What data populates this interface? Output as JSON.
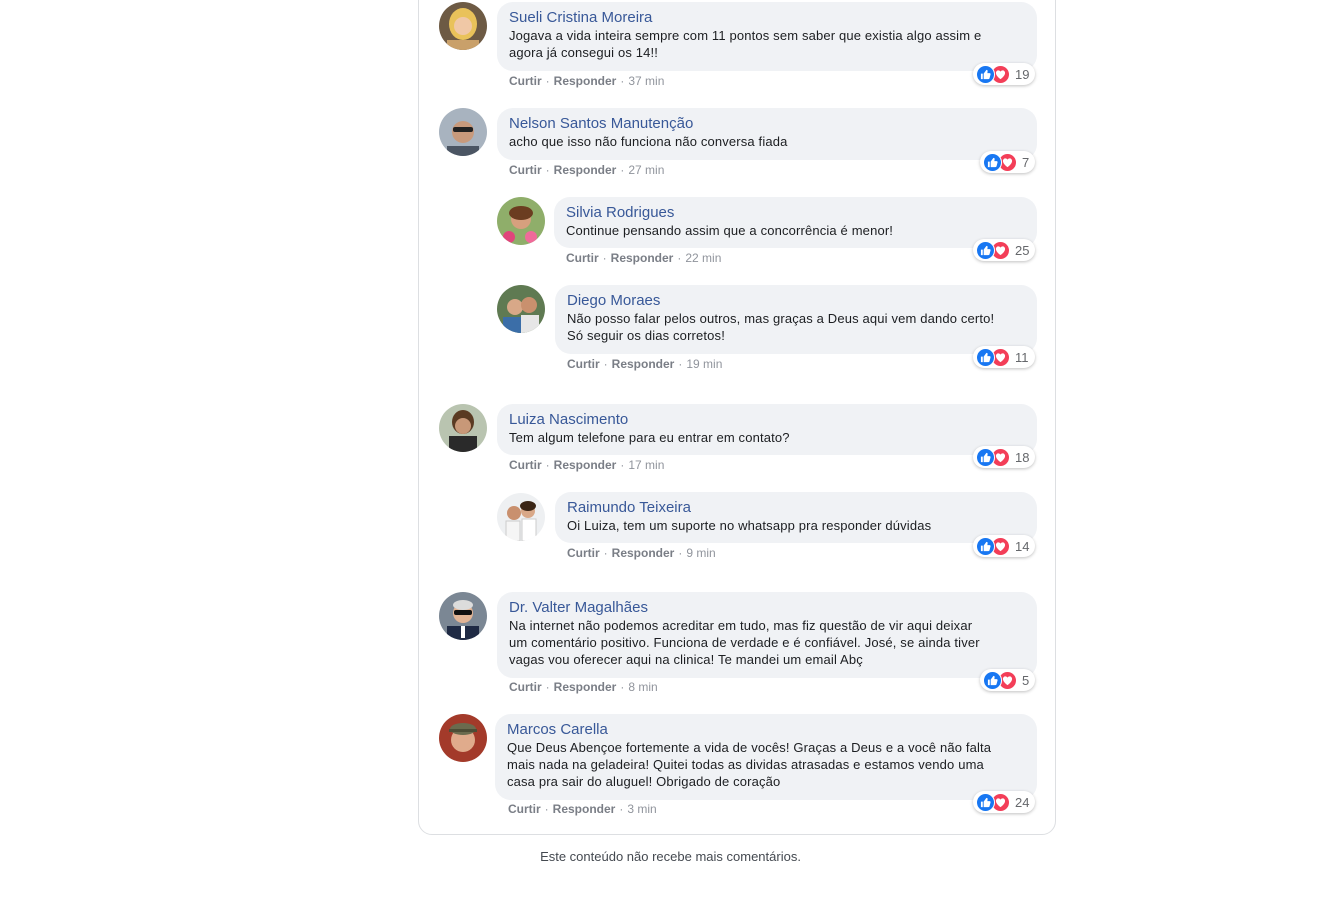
{
  "colors": {
    "name_link": "#385898",
    "bubble_bg": "#f0f2f5",
    "like_blue": "#1877f2",
    "love_red": "#f33e58"
  },
  "action_labels": {
    "like": "Curtir",
    "reply": "Responder",
    "separator": "·"
  },
  "comments": [
    {
      "name": "Sueli Cristina Moreira",
      "text": "Jogava a vida inteira sempre com 11 pontos sem saber que existia algo assim e\nagora já consegui os 14!!",
      "time": "37 min",
      "reactions": "19",
      "reaction_icons": [
        "like-icon",
        "love-icon"
      ]
    },
    {
      "name": "Nelson Santos Manutenção",
      "text": "acho que isso não funciona não conversa fiada",
      "time": "27 min",
      "reactions": "7",
      "reaction_icons": [
        "like-icon",
        "love-icon"
      ]
    },
    {
      "name": "Silvia Rodrigues",
      "text": "Continue pensando assim que a concorrência é menor!",
      "time": "22 min",
      "reactions": "25",
      "reaction_icons": [
        "like-icon",
        "love-icon"
      ],
      "reply": true
    },
    {
      "name": "Diego Moraes",
      "text": "Não posso falar pelos outros, mas graças a Deus aqui vem dando certo!\nSó seguir os dias corretos!",
      "time": "19 min",
      "reactions": "11",
      "reaction_icons": [
        "like-icon",
        "love-icon"
      ],
      "reply": true
    },
    {
      "name": "Luiza Nascimento",
      "text": "Tem algum telefone para eu entrar em contato?",
      "time": "17 min",
      "reactions": "18",
      "reaction_icons": [
        "like-icon",
        "love-icon"
      ]
    },
    {
      "name": "Raimundo Teixeira",
      "text": "Oi Luiza, tem um suporte no whatsapp pra responder dúvidas",
      "time": "9 min",
      "reactions": "14",
      "reaction_icons": [
        "like-icon",
        "love-icon"
      ],
      "reply": true
    },
    {
      "name": "Dr. Valter Magalhães",
      "text": "Na internet não podemos acreditar em tudo, mas fiz questão de vir aqui deixar\num comentário positivo. Funciona de verdade e é confiável. José, se ainda tiver\nvagas vou oferecer aqui na clinica! Te mandei um email Abç",
      "time": "8 min",
      "reactions": "5",
      "reaction_icons": [
        "like-icon",
        "love-icon"
      ]
    },
    {
      "name": "Marcos Carella",
      "text": "Que Deus Abençoe fortemente a vida de vocês! Graças a Deus e a você não falta\nmais nada na geladeira! Quitei todas as dividas atrasadas e estamos vendo uma\ncasa pra sair do aluguel! Obrigado de coração",
      "time": "3 min",
      "reactions": "24",
      "reaction_icons": [
        "like-icon",
        "love-icon"
      ]
    }
  ],
  "footer": {
    "closed_note": "Este conteúdo não recebe mais comentários."
  }
}
